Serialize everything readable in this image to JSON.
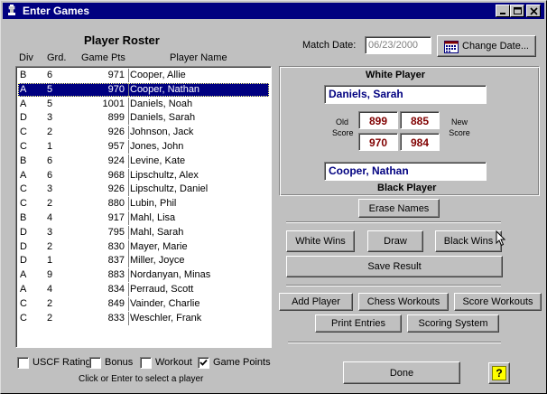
{
  "window": {
    "title": "Enter Games"
  },
  "roster": {
    "title": "Player Roster",
    "columns": {
      "div": "Div",
      "grd": "Grd.",
      "pts": "Game Pts",
      "name": "Player Name"
    },
    "rows": [
      {
        "div": "B",
        "grd": "6",
        "pts": "971",
        "name": "Cooper, Allie"
      },
      {
        "div": "A",
        "grd": "5",
        "pts": "970",
        "name": "Cooper, Nathan"
      },
      {
        "div": "A",
        "grd": "5",
        "pts": "1001",
        "name": "Daniels, Noah"
      },
      {
        "div": "D",
        "grd": "3",
        "pts": "899",
        "name": "Daniels, Sarah"
      },
      {
        "div": "C",
        "grd": "2",
        "pts": "926",
        "name": "Johnson, Jack"
      },
      {
        "div": "C",
        "grd": "1",
        "pts": "957",
        "name": "Jones, John"
      },
      {
        "div": "B",
        "grd": "6",
        "pts": "924",
        "name": "Levine, Kate"
      },
      {
        "div": "A",
        "grd": "6",
        "pts": "968",
        "name": "Lipschultz, Alex"
      },
      {
        "div": "C",
        "grd": "3",
        "pts": "926",
        "name": "Lipschultz, Daniel"
      },
      {
        "div": "C",
        "grd": "2",
        "pts": "880",
        "name": "Lubin, Phil"
      },
      {
        "div": "B",
        "grd": "4",
        "pts": "917",
        "name": "Mahl, Lisa"
      },
      {
        "div": "D",
        "grd": "3",
        "pts": "795",
        "name": "Mahl, Sarah"
      },
      {
        "div": "D",
        "grd": "2",
        "pts": "830",
        "name": "Mayer, Marie"
      },
      {
        "div": "D",
        "grd": "1",
        "pts": "837",
        "name": "Miller, Joyce"
      },
      {
        "div": "A",
        "grd": "9",
        "pts": "883",
        "name": "Nordanyan, Minas"
      },
      {
        "div": "A",
        "grd": "4",
        "pts": "834",
        "name": "Perraud, Scott"
      },
      {
        "div": "C",
        "grd": "2",
        "pts": "849",
        "name": "Vainder, Charlie"
      },
      {
        "div": "C",
        "grd": "2",
        "pts": "833",
        "name": "Weschler, Frank"
      }
    ],
    "selected_index": 1,
    "hint": "Click or Enter to select a player"
  },
  "options": {
    "usct": {
      "label": "USCF Rating",
      "checked": false
    },
    "bonus": {
      "label": "Bonus",
      "checked": false
    },
    "workout": {
      "label": "Workout",
      "checked": false
    },
    "game_points": {
      "label": "Game Points",
      "checked": true
    }
  },
  "match": {
    "date_label": "Match Date:",
    "date_value": "06/23/2000",
    "change_date_label": "Change Date..."
  },
  "game": {
    "white_label": "White Player",
    "white_name": "Daniels, Sarah",
    "black_label": "Black Player",
    "black_name": "Cooper, Nathan",
    "old_label": "Old Score",
    "new_label": "New Score",
    "white_old": "899",
    "white_new": "885",
    "black_old": "970",
    "black_new": "984"
  },
  "buttons": {
    "erase": "Erase Names",
    "white_wins": "White Wins",
    "draw": "Draw",
    "black_wins": "Black Wins",
    "save": "Save Result",
    "add_player": "Add Player",
    "chess_workouts": "Chess Workouts",
    "score_workouts": "Score Workouts",
    "print_entries": "Print Entries",
    "scoring_system": "Scoring System",
    "done": "Done",
    "help": "?"
  },
  "colors": {
    "titlebar": "#000080",
    "face": "#c0c0c0",
    "selection": "#000080",
    "name_text": "#000080",
    "score_text": "#800000",
    "help_bg": "#ffff00"
  }
}
